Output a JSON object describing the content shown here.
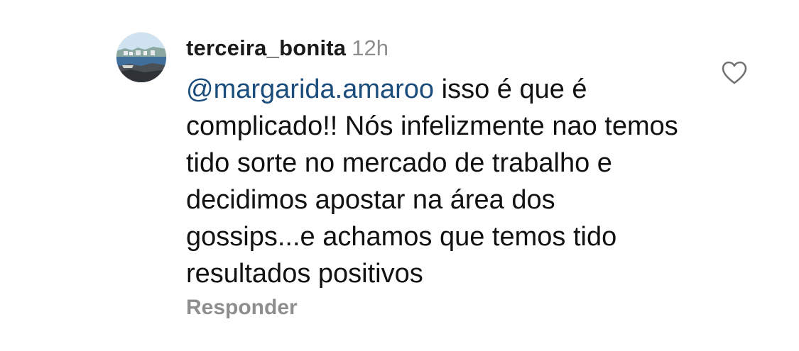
{
  "comment": {
    "username": "terceira_bonita",
    "time": "12h",
    "mention": "@margarida.amaroo",
    "text": "isso é que é complicado!! Nós infelizmente nao temos tido sorte no mercado de trabalho e decidimos apostar na área dos gossips...e achamos que temos tido resultados positivos",
    "reply_label": "Responder"
  },
  "icons": {
    "like": "heart-outline-icon",
    "avatar": "profile-photo-coastal-town"
  },
  "colors": {
    "mention": "#1a4c7c",
    "muted": "#8e8e8e",
    "text": "#111111",
    "background": "#ffffff"
  }
}
